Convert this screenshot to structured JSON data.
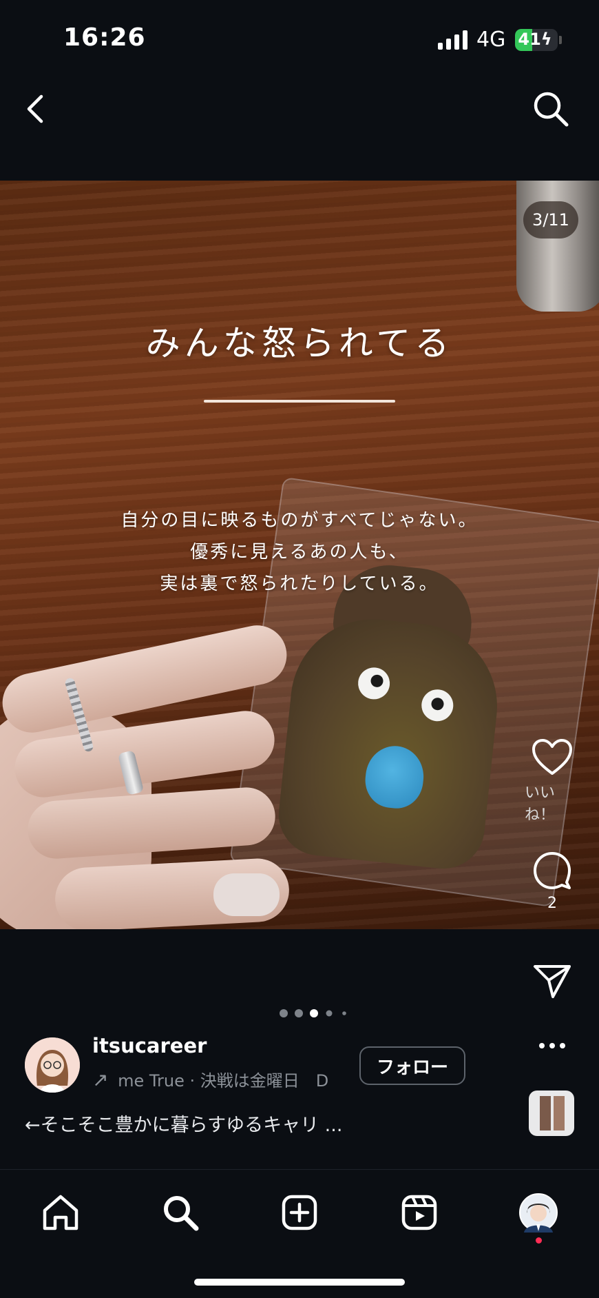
{
  "status_bar": {
    "time": "16:26",
    "network": "4G",
    "battery": "41",
    "battery_level": 0.41
  },
  "header": {
    "back_icon": "chevron-left-icon",
    "search_icon": "search-icon"
  },
  "post": {
    "image_counter": "3/11",
    "headline": "みんな怒られてる",
    "body_lines": [
      "自分の目に映るものがすべてじゃない。",
      "優秀に見えるあの人も、",
      "実は裏で怒られたりしている。"
    ],
    "carousel": {
      "dot_count": 5,
      "active_index": 2
    }
  },
  "actions": {
    "like_label": "いいね！",
    "comment_count": "2"
  },
  "author": {
    "username": "itsucareer",
    "subline": "me True · 決戦は金曜日　D",
    "follow_label": "フォロー",
    "caption": "←そこそこ豊かに暮らすゆるキャリ ..."
  },
  "colors": {
    "background": "#0b0e13",
    "battery_green": "#34c759",
    "notification_red": "#ff2d55"
  },
  "tabbar": {
    "items": [
      "home-icon",
      "search-icon",
      "create-icon",
      "reels-icon",
      "profile-avatar"
    ]
  }
}
